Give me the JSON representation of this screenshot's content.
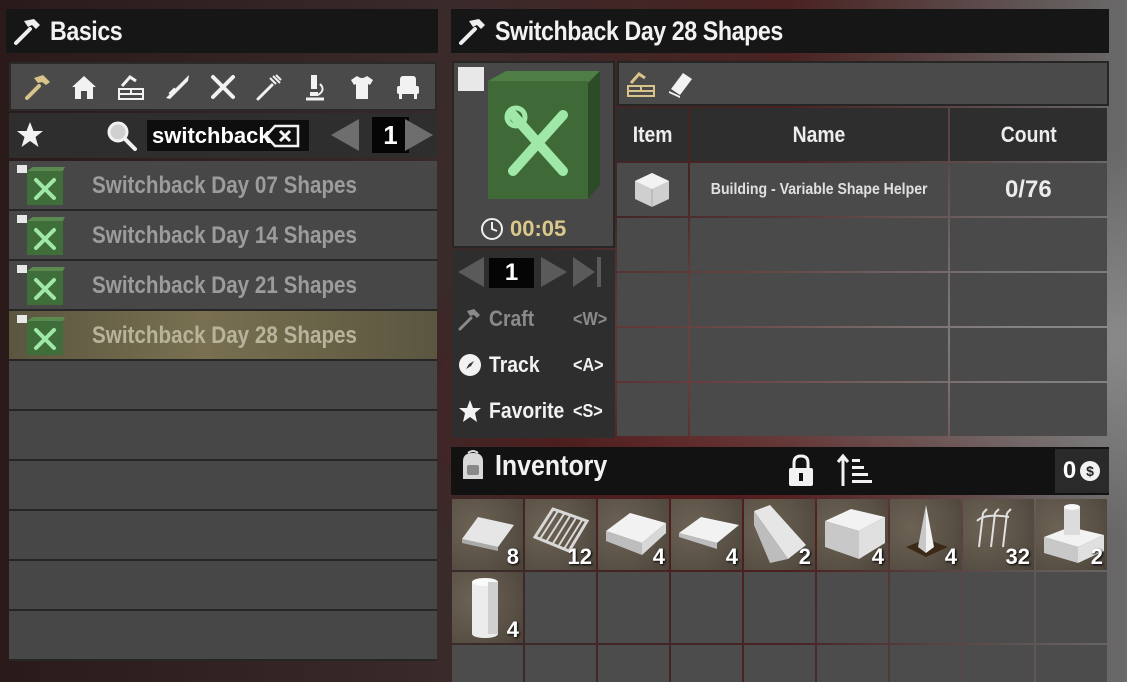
{
  "left_panel": {
    "title": "Basics",
    "categories": [
      "hammer-icon",
      "house-icon",
      "building-icon",
      "weapon-icon",
      "tools-icon",
      "food-icon",
      "science-icon",
      "clothing-icon",
      "decor-icon"
    ],
    "search": {
      "value": "switchback"
    },
    "page": "1",
    "recipes": [
      {
        "name": "Switchback Day 07 Shapes",
        "selected": false
      },
      {
        "name": "Switchback Day 14 Shapes",
        "selected": false
      },
      {
        "name": "Switchback Day 21 Shapes",
        "selected": false
      },
      {
        "name": "Switchback Day 28 Shapes",
        "selected": true
      }
    ]
  },
  "right_panel": {
    "title": "Switchback Day 28 Shapes",
    "craft_time": "00:05",
    "quantity": "1",
    "actions": {
      "craft": {
        "label": "Craft",
        "key": "<W>"
      },
      "track": {
        "label": "Track",
        "key": "<A>"
      },
      "favorite": {
        "label": "Favorite",
        "key": "<S>"
      }
    },
    "ingredients": {
      "headers": {
        "item": "Item",
        "name": "Name",
        "count": "Count"
      },
      "rows": [
        {
          "name": "Building - Variable Shape Helper",
          "count": "0/76"
        }
      ]
    }
  },
  "inventory": {
    "title": "Inventory",
    "currency": "0",
    "slots": [
      {
        "icon": "ramp-plate-icon",
        "count": "8"
      },
      {
        "icon": "grate-icon",
        "count": "12"
      },
      {
        "icon": "wedge-block-icon",
        "count": "4"
      },
      {
        "icon": "wedge-flat-icon",
        "count": "4"
      },
      {
        "icon": "steep-ramp-icon",
        "count": "2"
      },
      {
        "icon": "cube-block-icon",
        "count": "4"
      },
      {
        "icon": "pyramid-icon",
        "count": "4"
      },
      {
        "icon": "rebar-icon",
        "count": "32"
      },
      {
        "icon": "pillar-cap-icon",
        "count": "2"
      },
      {
        "icon": "cylinder-icon",
        "count": "4"
      }
    ]
  },
  "colors": {
    "selected_row": "#787050",
    "craft_time": "#d9c98a",
    "recipe_text": "#9c9c9c"
  }
}
